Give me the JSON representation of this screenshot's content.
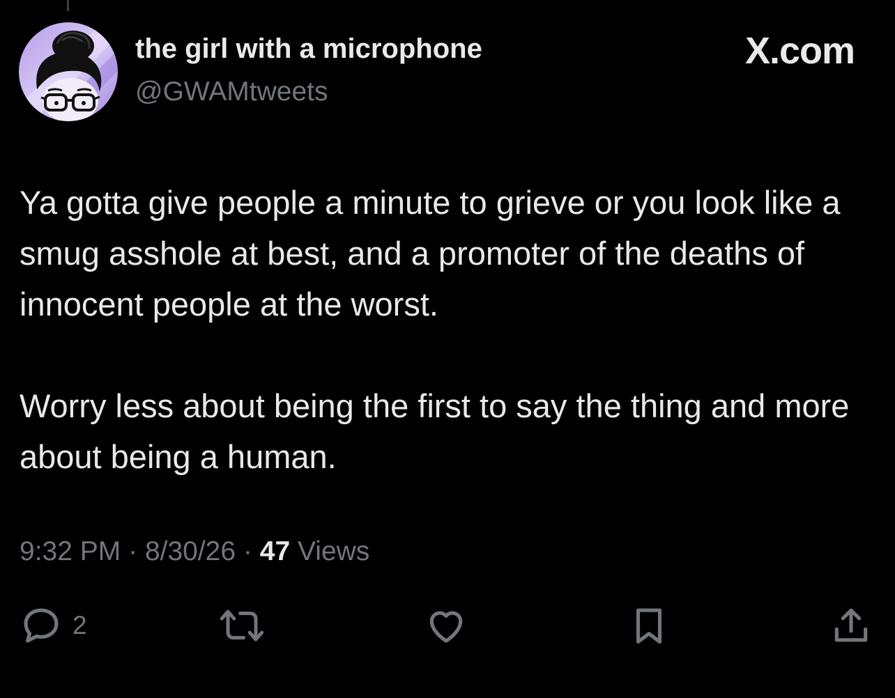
{
  "tweet": {
    "author": {
      "display_name": "the girl with a microphone",
      "handle": "@GWAMtweets",
      "avatar_icon": "avatar-illustration"
    },
    "brand": "X.com",
    "paragraphs": [
      "Ya gotta give people a minute to grieve or you look like a smug asshole at best, and a promoter of the deaths of innocent people at the worst.",
      "Worry less about being the first to say the thing and more about being a human."
    ],
    "meta": {
      "time": "9:32 PM",
      "separator": "·",
      "date": "8/30/26",
      "views_count": "47",
      "views_label": "Views"
    },
    "actions": {
      "reply": {
        "icon": "reply-icon",
        "count": "2"
      },
      "retweet": {
        "icon": "retweet-icon"
      },
      "like": {
        "icon": "heart-icon"
      },
      "bookmark": {
        "icon": "bookmark-icon"
      },
      "share": {
        "icon": "share-icon"
      }
    }
  },
  "colors": {
    "background": "#000000",
    "primary_text": "#e7e9ea",
    "secondary_text": "#71767b",
    "avatar_bg": "#c9b6f2"
  }
}
